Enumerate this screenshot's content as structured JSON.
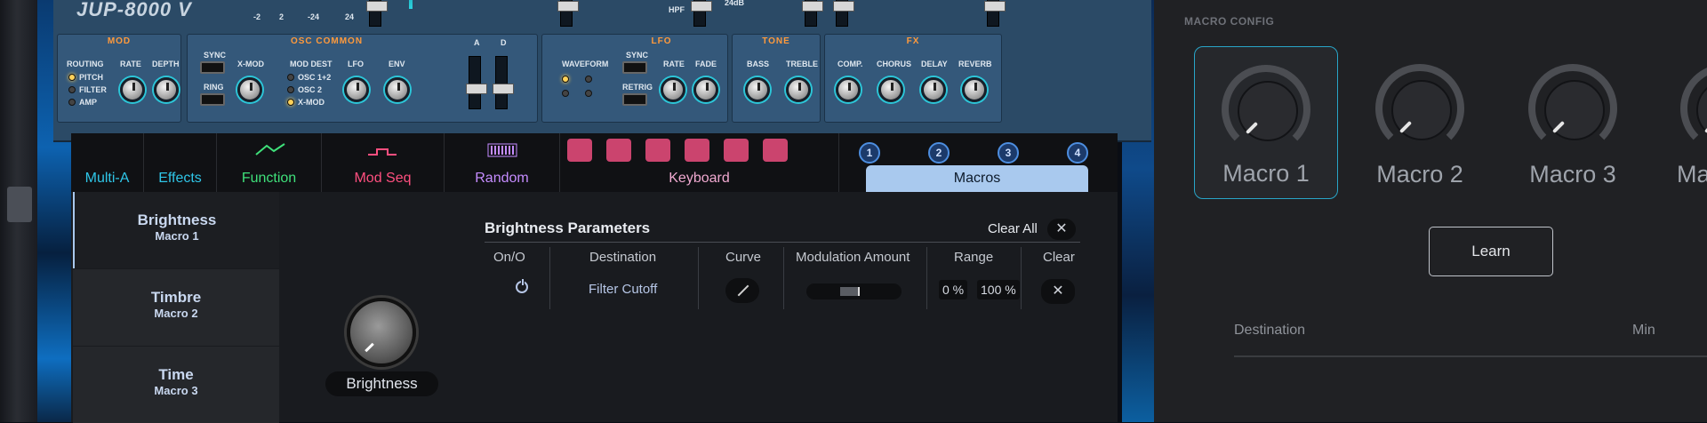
{
  "synth": {
    "brand": "JUP-8000 V",
    "top_labels": [
      "-2",
      "2",
      "-24",
      "24",
      "HPF",
      "24dB"
    ],
    "mod": {
      "title": "MOD",
      "routing": "ROUTING",
      "rate": "RATE",
      "depth": "DEPTH",
      "options": [
        "PITCH",
        "FILTER",
        "AMP"
      ]
    },
    "osc": {
      "title": "OSC COMMON",
      "sync": "SYNC",
      "ring": "RING",
      "xmod": "X-MOD",
      "mod_dest": "MOD DEST",
      "dest_options": [
        "OSC 1+2",
        "OSC 2",
        "X-MOD"
      ],
      "lfo": "LFO",
      "env": "ENV",
      "a": "A",
      "d": "D"
    },
    "lfo": {
      "title": "LFO",
      "waveform": "WAVEFORM",
      "sync": "SYNC",
      "retrig": "RETRIG",
      "rate": "RATE",
      "fade": "FADE"
    },
    "tone": {
      "title": "TONE",
      "bass": "BASS",
      "treble": "TREBLE"
    },
    "fx": {
      "title": "FX",
      "comp": "COMP.",
      "chorus": "CHORUS",
      "delay": "DELAY",
      "reverb": "REVERB"
    }
  },
  "tabs": [
    {
      "label": "Multi-A",
      "color": "#2fc6e8"
    },
    {
      "label": "Effects",
      "color": "#2fc6e8"
    },
    {
      "label": "Function",
      "color": "#3fe07a"
    },
    {
      "label": "Mod Seq",
      "color": "#ff4f7f"
    },
    {
      "label": "Random",
      "color": "#c58cff"
    },
    {
      "label": "Keyboard",
      "color": "#f0a9d0"
    },
    {
      "label": "Macros",
      "color": "#0d1a2a"
    }
  ],
  "macro_numbers": [
    "1",
    "2",
    "3",
    "4"
  ],
  "macro_list": [
    {
      "name": "Brightness",
      "sub": "Macro 1"
    },
    {
      "name": "Timbre",
      "sub": "Macro 2"
    },
    {
      "name": "Time",
      "sub": "Macro 3"
    }
  ],
  "selected_macro_label": "Brightness",
  "params": {
    "title": "Brightness Parameters",
    "clear_all": "Clear All",
    "headers": [
      "On/O",
      "Destination",
      "Curve",
      "Modulation Amount",
      "Range",
      "Clear"
    ],
    "row": {
      "destination": "Filter Cutoff",
      "range_min": "0 %",
      "range_max": "100 %"
    }
  },
  "config": {
    "title": "MACRO CONFIG",
    "macros": [
      "Macro 1",
      "Macro 2",
      "Macro 3",
      "Ma"
    ],
    "learn": "Learn",
    "col_destination": "Destination",
    "col_min": "Min"
  }
}
